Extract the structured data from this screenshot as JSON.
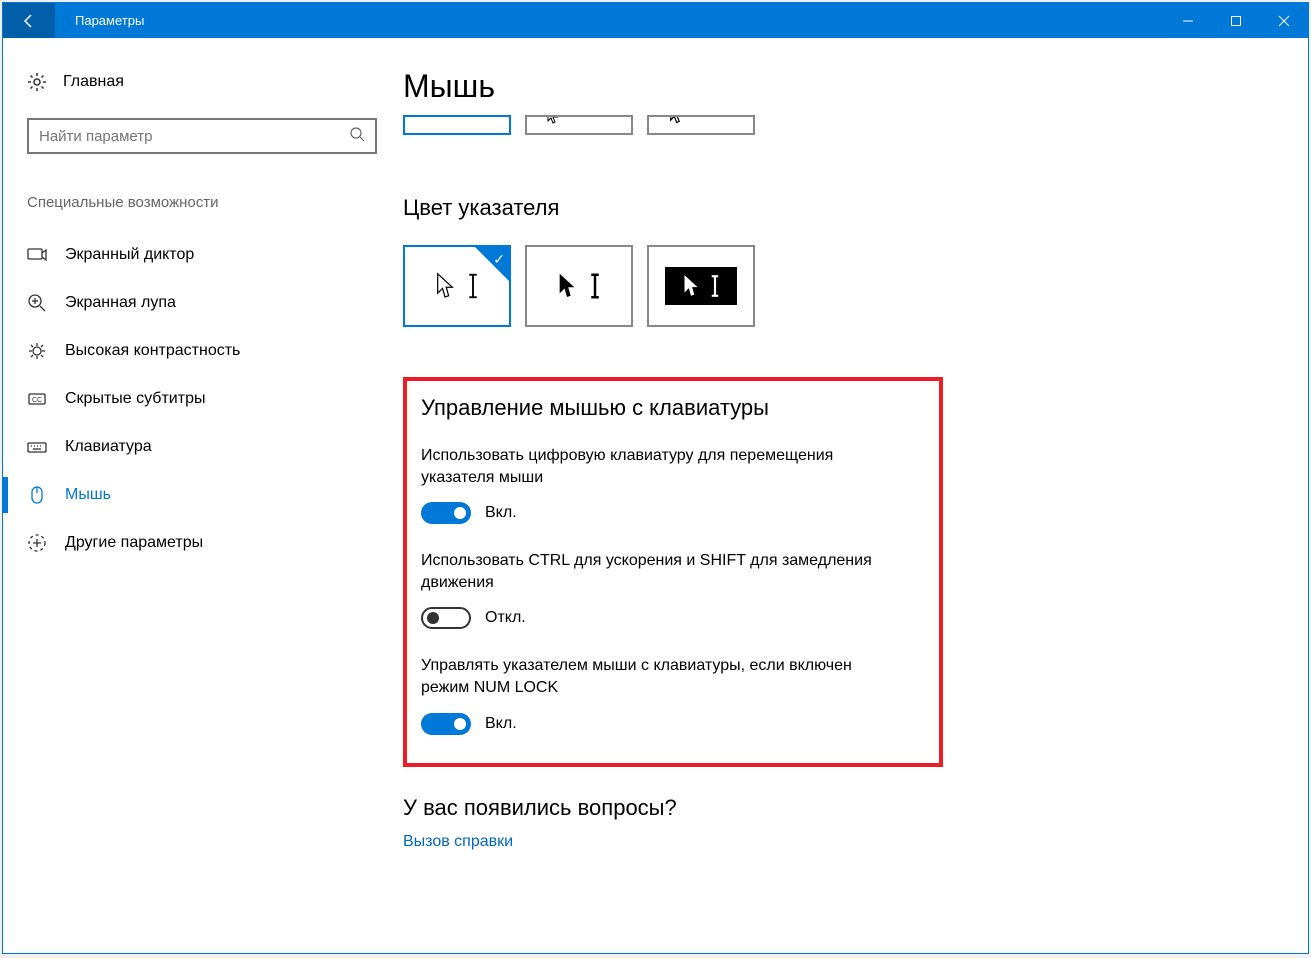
{
  "titlebar": {
    "title": "Параметры"
  },
  "sidebar": {
    "home": "Главная",
    "search_placeholder": "Найти параметр",
    "category": "Специальные возможности",
    "items": [
      {
        "label": "Экранный диктор"
      },
      {
        "label": "Экранная лупа"
      },
      {
        "label": "Высокая контрастность"
      },
      {
        "label": "Скрытые субтитры"
      },
      {
        "label": "Клавиатура"
      },
      {
        "label": "Мышь"
      },
      {
        "label": "Другие параметры"
      }
    ]
  },
  "main": {
    "title": "Мышь",
    "pointer_color_heading": "Цвет указателя",
    "keyboard_control_heading": "Управление мышью с клавиатуры",
    "settings": [
      {
        "text": "Использовать цифровую клавиатуру для перемещения указателя мыши",
        "state": "Вкл."
      },
      {
        "text": "Использовать CTRL для ускорения и SHIFT для замедления движения",
        "state": "Откл."
      },
      {
        "text": "Управлять указателем мыши с клавиатуры, если включен режим NUM LOCK",
        "state": "Вкл."
      }
    ],
    "questions_heading": "У вас появились вопросы?",
    "help_link": "Вызов справки"
  }
}
